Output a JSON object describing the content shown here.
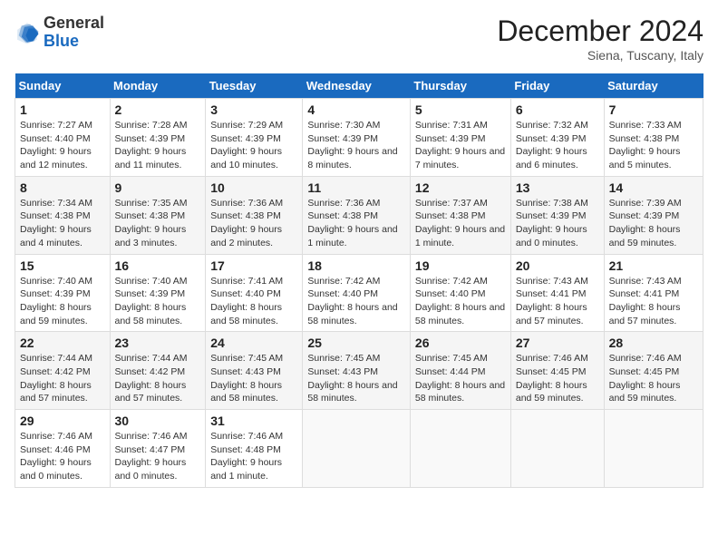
{
  "header": {
    "logo_general": "General",
    "logo_blue": "Blue",
    "month_title": "December 2024",
    "subtitle": "Siena, Tuscany, Italy"
  },
  "weekdays": [
    "Sunday",
    "Monday",
    "Tuesday",
    "Wednesday",
    "Thursday",
    "Friday",
    "Saturday"
  ],
  "weeks": [
    [
      {
        "day": "1",
        "info": "Sunrise: 7:27 AM\nSunset: 4:40 PM\nDaylight: 9 hours and 12 minutes."
      },
      {
        "day": "2",
        "info": "Sunrise: 7:28 AM\nSunset: 4:39 PM\nDaylight: 9 hours and 11 minutes."
      },
      {
        "day": "3",
        "info": "Sunrise: 7:29 AM\nSunset: 4:39 PM\nDaylight: 9 hours and 10 minutes."
      },
      {
        "day": "4",
        "info": "Sunrise: 7:30 AM\nSunset: 4:39 PM\nDaylight: 9 hours and 8 minutes."
      },
      {
        "day": "5",
        "info": "Sunrise: 7:31 AM\nSunset: 4:39 PM\nDaylight: 9 hours and 7 minutes."
      },
      {
        "day": "6",
        "info": "Sunrise: 7:32 AM\nSunset: 4:39 PM\nDaylight: 9 hours and 6 minutes."
      },
      {
        "day": "7",
        "info": "Sunrise: 7:33 AM\nSunset: 4:38 PM\nDaylight: 9 hours and 5 minutes."
      }
    ],
    [
      {
        "day": "8",
        "info": "Sunrise: 7:34 AM\nSunset: 4:38 PM\nDaylight: 9 hours and 4 minutes."
      },
      {
        "day": "9",
        "info": "Sunrise: 7:35 AM\nSunset: 4:38 PM\nDaylight: 9 hours and 3 minutes."
      },
      {
        "day": "10",
        "info": "Sunrise: 7:36 AM\nSunset: 4:38 PM\nDaylight: 9 hours and 2 minutes."
      },
      {
        "day": "11",
        "info": "Sunrise: 7:36 AM\nSunset: 4:38 PM\nDaylight: 9 hours and 1 minute."
      },
      {
        "day": "12",
        "info": "Sunrise: 7:37 AM\nSunset: 4:38 PM\nDaylight: 9 hours and 1 minute."
      },
      {
        "day": "13",
        "info": "Sunrise: 7:38 AM\nSunset: 4:39 PM\nDaylight: 9 hours and 0 minutes."
      },
      {
        "day": "14",
        "info": "Sunrise: 7:39 AM\nSunset: 4:39 PM\nDaylight: 8 hours and 59 minutes."
      }
    ],
    [
      {
        "day": "15",
        "info": "Sunrise: 7:40 AM\nSunset: 4:39 PM\nDaylight: 8 hours and 59 minutes."
      },
      {
        "day": "16",
        "info": "Sunrise: 7:40 AM\nSunset: 4:39 PM\nDaylight: 8 hours and 58 minutes."
      },
      {
        "day": "17",
        "info": "Sunrise: 7:41 AM\nSunset: 4:40 PM\nDaylight: 8 hours and 58 minutes."
      },
      {
        "day": "18",
        "info": "Sunrise: 7:42 AM\nSunset: 4:40 PM\nDaylight: 8 hours and 58 minutes."
      },
      {
        "day": "19",
        "info": "Sunrise: 7:42 AM\nSunset: 4:40 PM\nDaylight: 8 hours and 58 minutes."
      },
      {
        "day": "20",
        "info": "Sunrise: 7:43 AM\nSunset: 4:41 PM\nDaylight: 8 hours and 57 minutes."
      },
      {
        "day": "21",
        "info": "Sunrise: 7:43 AM\nSunset: 4:41 PM\nDaylight: 8 hours and 57 minutes."
      }
    ],
    [
      {
        "day": "22",
        "info": "Sunrise: 7:44 AM\nSunset: 4:42 PM\nDaylight: 8 hours and 57 minutes."
      },
      {
        "day": "23",
        "info": "Sunrise: 7:44 AM\nSunset: 4:42 PM\nDaylight: 8 hours and 57 minutes."
      },
      {
        "day": "24",
        "info": "Sunrise: 7:45 AM\nSunset: 4:43 PM\nDaylight: 8 hours and 58 minutes."
      },
      {
        "day": "25",
        "info": "Sunrise: 7:45 AM\nSunset: 4:43 PM\nDaylight: 8 hours and 58 minutes."
      },
      {
        "day": "26",
        "info": "Sunrise: 7:45 AM\nSunset: 4:44 PM\nDaylight: 8 hours and 58 minutes."
      },
      {
        "day": "27",
        "info": "Sunrise: 7:46 AM\nSunset: 4:45 PM\nDaylight: 8 hours and 59 minutes."
      },
      {
        "day": "28",
        "info": "Sunrise: 7:46 AM\nSunset: 4:45 PM\nDaylight: 8 hours and 59 minutes."
      }
    ],
    [
      {
        "day": "29",
        "info": "Sunrise: 7:46 AM\nSunset: 4:46 PM\nDaylight: 9 hours and 0 minutes."
      },
      {
        "day": "30",
        "info": "Sunrise: 7:46 AM\nSunset: 4:47 PM\nDaylight: 9 hours and 0 minutes."
      },
      {
        "day": "31",
        "info": "Sunrise: 7:46 AM\nSunset: 4:48 PM\nDaylight: 9 hours and 1 minute."
      },
      null,
      null,
      null,
      null
    ]
  ]
}
